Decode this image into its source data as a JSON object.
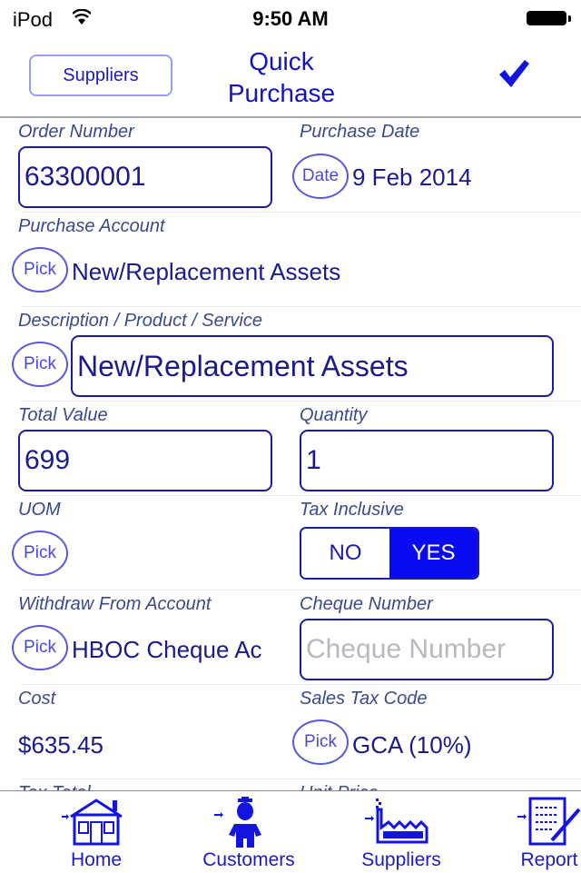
{
  "status_bar": {
    "carrier": "iPod",
    "time": "9:50 AM",
    "wifi_icon": "wifi-icon",
    "battery_icon": "battery-full-icon"
  },
  "nav": {
    "back_label": "Suppliers",
    "title_line1": "Quick",
    "title_line2": "Purchase",
    "done_icon": "checkmark-icon"
  },
  "form": {
    "order_number": {
      "label": "Order Number",
      "value": "63300001"
    },
    "purchase_date": {
      "label": "Purchase Date",
      "button": "Date",
      "value": "9 Feb 2014"
    },
    "purchase_account": {
      "label": "Purchase Account",
      "button": "Pick",
      "value": "New/Replacement Assets"
    },
    "description": {
      "label": "Description / Product / Service",
      "button": "Pick",
      "value": "New/Replacement Assets"
    },
    "total_value": {
      "label": "Total Value",
      "value": "699"
    },
    "quantity": {
      "label": "Quantity",
      "value": "1"
    },
    "uom": {
      "label": "UOM",
      "button": "Pick"
    },
    "tax_inclusive": {
      "label": "Tax Inclusive",
      "options": [
        "NO",
        "YES"
      ],
      "selected": "YES"
    },
    "withdraw_account": {
      "label": "Withdraw From Account",
      "button": "Pick",
      "value": "HBOC Cheque Ac"
    },
    "cheque_number": {
      "label": "Cheque Number",
      "value": "",
      "placeholder": "Cheque Number"
    },
    "cost": {
      "label": "Cost",
      "value": "$635.45"
    },
    "sales_tax_code": {
      "label": "Sales Tax Code",
      "button": "Pick",
      "value": "GCA (10%)"
    },
    "tax_total": {
      "label": "Tax Total"
    },
    "unit_price": {
      "label": "Unit Price"
    }
  },
  "tabbar": {
    "items": [
      {
        "label": "Home",
        "icon": "home-icon"
      },
      {
        "label": "Customers",
        "icon": "customer-person-icon"
      },
      {
        "label": "Suppliers",
        "icon": "factory-icon"
      },
      {
        "label": "Report",
        "icon": "report-icon"
      }
    ]
  },
  "colors": {
    "accent": "#1212c8",
    "selected_segment": "#0a0af0",
    "label": "#3a4a8a",
    "value_text": "#1a1a8c"
  }
}
